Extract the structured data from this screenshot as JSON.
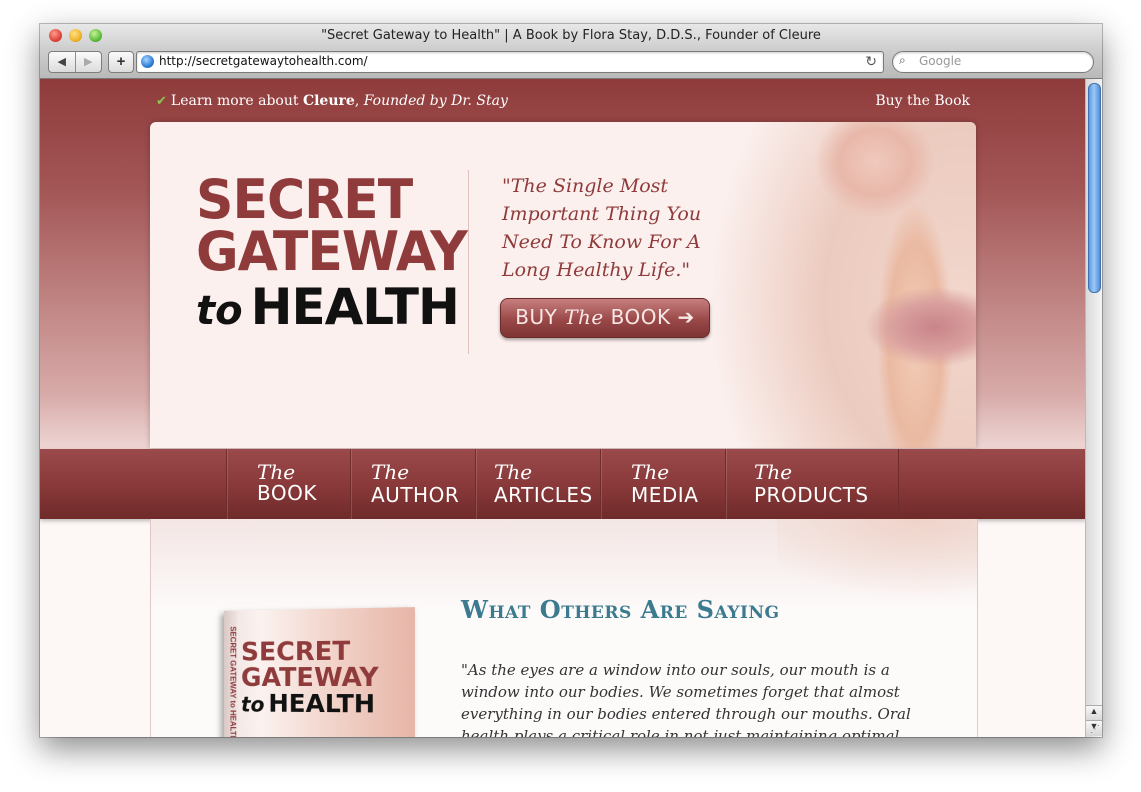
{
  "window": {
    "title": "\"Secret Gateway to Health\" | A Book by Flora Stay, D.D.S., Founder of Cleure"
  },
  "toolbar": {
    "back_label": "◀",
    "forward_label": "▶",
    "add_label": "+",
    "url": "http://secretgatewaytohealth.com/",
    "reload_icon": "↻",
    "search_placeholder": "Google",
    "search_icon": "⌕"
  },
  "topbar": {
    "check_icon": "✔",
    "learn_prefix": "Learn more about ",
    "learn_brand": "Cleure",
    "learn_sep": ", ",
    "learn_suffix": "Founded by Dr. Stay",
    "buy_link": "Buy the Book"
  },
  "hero": {
    "logo_line1": "SECRET",
    "logo_line2": "GATEWAY",
    "logo_to": "to",
    "logo_health": "HEALTH",
    "tagline": "\"The Single Most Important Thing You Need To Know For A Long Healthy Life.\"",
    "buy_button_pre": "BUY ",
    "buy_button_the": "The",
    "buy_button_post": " BOOK ➔"
  },
  "nav": {
    "items": [
      {
        "the": "The",
        "word": "BOOK"
      },
      {
        "the": "The",
        "word": "AUTHOR"
      },
      {
        "the": "The",
        "word": "ARTICLES"
      },
      {
        "the": "The",
        "word": "MEDIA"
      },
      {
        "the": "The",
        "word": "PRODUCTS"
      }
    ]
  },
  "content": {
    "book_spine": "SECRET GATEWAY to HEALTH",
    "book_title1": "SECRET",
    "book_title2": "GATEWAY",
    "book_to": "to",
    "book_health": "HEALTH",
    "heading": "What Others Are Saying",
    "quote": "\"As the eyes are a window into our souls, our mouth is a window into our bodies. We sometimes forget that almost everything in our bodies entered through our mouths. Oral health plays a critical role in not just maintaining optimal health, but in the diagnosis"
  },
  "colors": {
    "brand": "#8f3b3b",
    "heading": "#3b7a8f",
    "nav_bg": "#8a3a3a"
  }
}
